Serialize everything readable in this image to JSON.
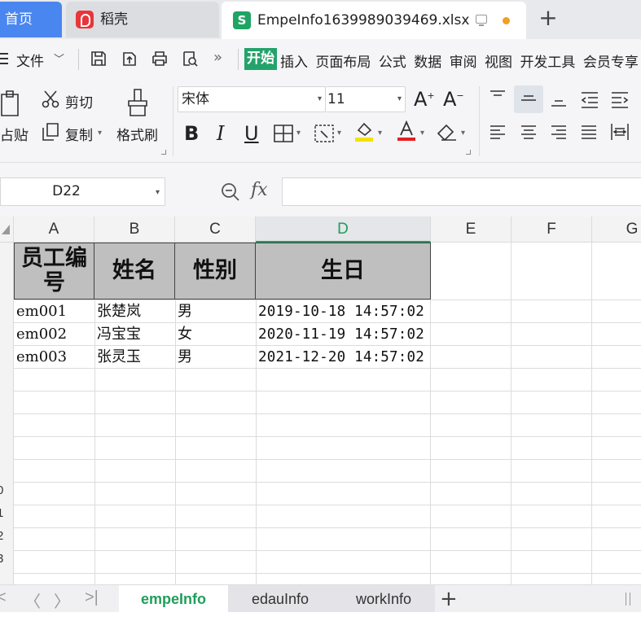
{
  "tabs": {
    "home": "首页",
    "daoke": "稻壳",
    "file": "EmpeInfo1639989039469.xlsx",
    "new_tab": "+"
  },
  "menu": {
    "file": "文件",
    "start": "开始",
    "items": [
      "插入",
      "页面布局",
      "公式",
      "数据",
      "审阅",
      "视图",
      "开发工具",
      "会员专享"
    ],
    "more": "»"
  },
  "ribbon": {
    "cut": "剪切",
    "copy": "复制",
    "paste_partial": "占贴",
    "format_painter": "格式刷",
    "font_name": "宋体",
    "font_size": "11",
    "bold": "B",
    "italic": "I",
    "underline": "U"
  },
  "formula_bar": {
    "cell_ref": "D22",
    "fx": "fx",
    "value": ""
  },
  "columns": [
    "A",
    "B",
    "C",
    "D",
    "E",
    "F",
    "G"
  ],
  "active_column": "D",
  "row_numbers_visible": [
    "0",
    "1",
    "2",
    "3"
  ],
  "sheet": {
    "headers": [
      "员工编号",
      "姓名",
      "性别",
      "生日"
    ],
    "rows": [
      [
        "em001",
        "张楚岚",
        "男",
        "2019-10-18 14:57:02"
      ],
      [
        "em002",
        "冯宝宝",
        "女",
        "2020-11-19 14:57:02"
      ],
      [
        "em003",
        "张灵玉",
        "男",
        "2021-12-20 14:57:02"
      ]
    ]
  },
  "sheet_tabs": [
    "empeInfo",
    "edauInfo",
    "workInfo"
  ],
  "active_sheet": "empeInfo",
  "colors": {
    "accent_green": "#1f9e5a",
    "home_tab_blue": "#4a86ef",
    "header_fill": "#bfbfbf"
  }
}
